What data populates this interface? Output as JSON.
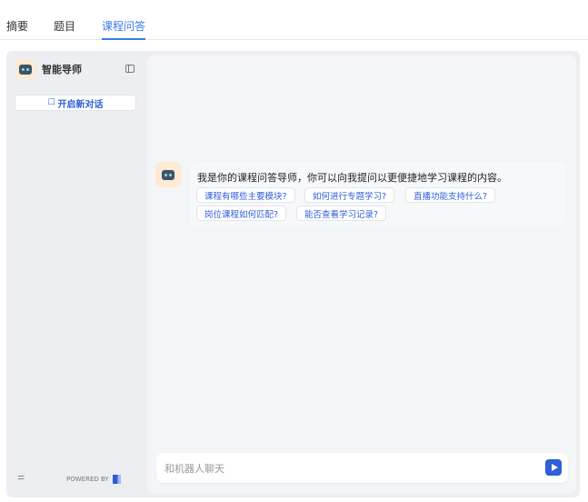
{
  "tabs": [
    {
      "label": "摘要"
    },
    {
      "label": "题目"
    },
    {
      "label": "课程问答",
      "active": true
    }
  ],
  "sidebar": {
    "title": "智能导师",
    "new_chat": "开启新对话",
    "powered_by": "POWERED BY"
  },
  "chat": {
    "message": "我是你的课程问答导师，你可以向我提问以更便捷地学习课程的内容。",
    "suggestions": [
      "课程有哪些主要模块?",
      "如何进行专题学习?",
      "直播功能支持什么?",
      "岗位课程如何匹配?",
      "能否查看学习记录?"
    ]
  },
  "input": {
    "placeholder": "和机器人聊天",
    "value": ""
  },
  "colors": {
    "accent": "#3b7be8",
    "brand": "#2f5ed8"
  }
}
